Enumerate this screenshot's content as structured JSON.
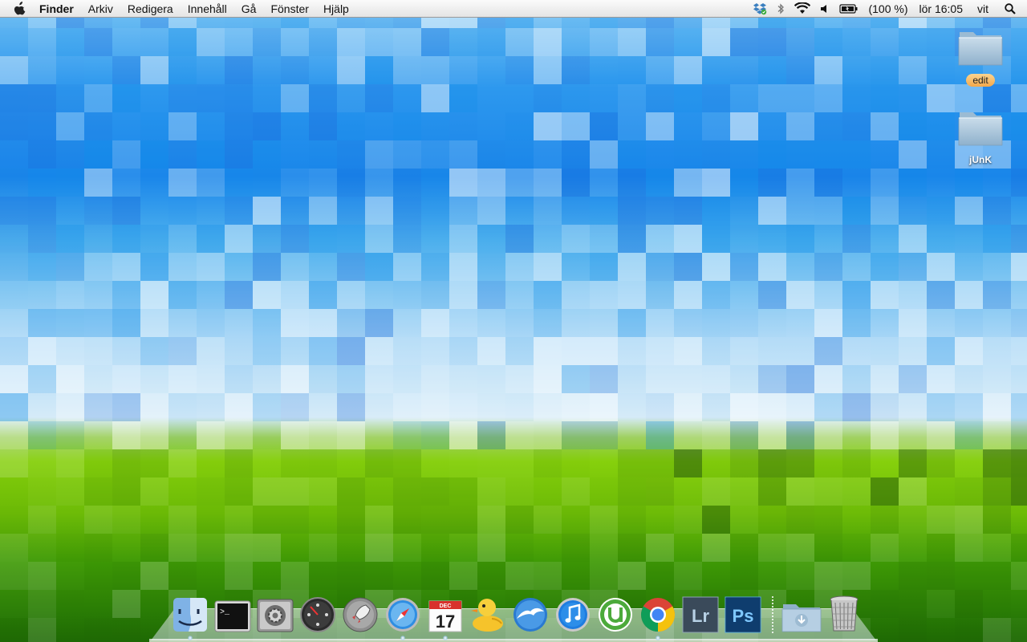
{
  "menubar": {
    "apple_icon": "apple-icon",
    "app_name": "Finder",
    "menus": [
      "Arkiv",
      "Redigera",
      "Innehåll",
      "Gå",
      "Fönster",
      "Hjälp"
    ],
    "status": {
      "battery_text": "(100 %)",
      "clock": "lör 16:05",
      "user": "vit",
      "icons": [
        "dropbox-icon",
        "bluetooth-icon",
        "wifi-icon",
        "volume-icon",
        "battery-icon",
        "spotlight-icon"
      ]
    }
  },
  "desktop": {
    "items": [
      {
        "label": "edit",
        "icon": "folder-icon",
        "label_color": "#f4a84a"
      },
      {
        "label": "jUnK",
        "icon": "folder-icon"
      }
    ]
  },
  "dock": {
    "apps": [
      {
        "name": "Finder",
        "icon": "finder-icon",
        "running": true
      },
      {
        "name": "Terminal",
        "icon": "terminal-icon",
        "running": false
      },
      {
        "name": "Systeminställningar",
        "icon": "system-preferences-icon",
        "running": false
      },
      {
        "name": "Dashboard",
        "icon": "dashboard-icon",
        "running": false
      },
      {
        "name": "Launchpad",
        "icon": "launchpad-icon",
        "running": false
      },
      {
        "name": "Safari",
        "icon": "safari-icon",
        "running": true
      },
      {
        "name": "iCal",
        "icon": "calendar-icon",
        "running": true,
        "month": "DEC",
        "day": "17"
      },
      {
        "name": "Cyberduck",
        "icon": "cyberduck-icon",
        "running": false
      },
      {
        "name": "OpenOffice",
        "icon": "openoffice-icon",
        "running": false
      },
      {
        "name": "iTunes",
        "icon": "itunes-icon",
        "running": false
      },
      {
        "name": "uTorrent",
        "icon": "utorrent-icon",
        "running": false
      },
      {
        "name": "Google Chrome",
        "icon": "chrome-icon",
        "running": true
      },
      {
        "name": "Lightroom",
        "icon": "lightroom-icon",
        "running": false,
        "text": "Lr"
      },
      {
        "name": "Photoshop",
        "icon": "photoshop-icon",
        "running": false,
        "text": "Ps"
      }
    ],
    "stacks": [
      {
        "name": "Hämtade filer",
        "icon": "downloads-folder-icon"
      },
      {
        "name": "Papperskorg",
        "icon": "trash-icon"
      }
    ]
  },
  "colors": {
    "menubar_bg": "#ececec",
    "tag_orange": "#f4a84a"
  }
}
